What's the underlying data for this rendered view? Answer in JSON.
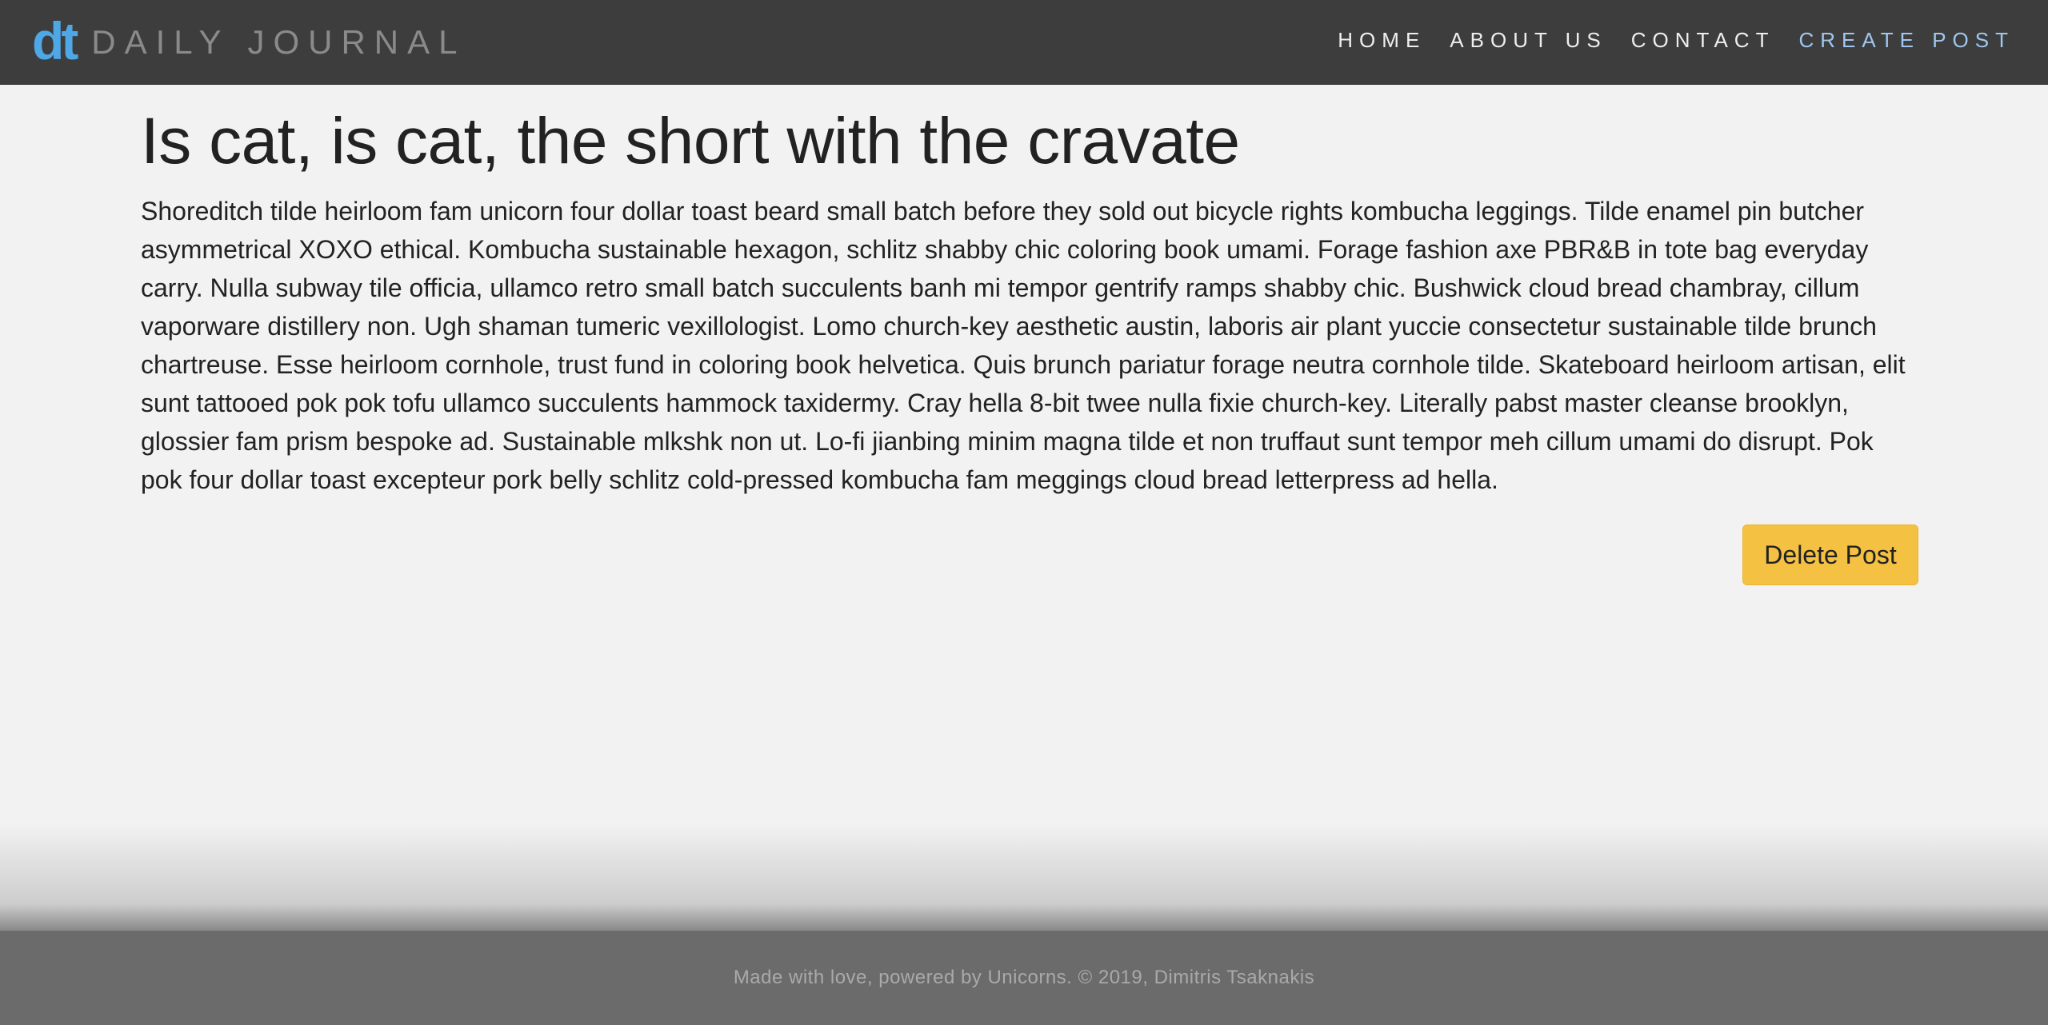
{
  "header": {
    "logo_text": "dt",
    "brand_name": "DAILY JOURNAL",
    "nav": {
      "home": "HOME",
      "about": "ABOUT US",
      "contact": "CONTACT",
      "create_post": "CREATE POST"
    }
  },
  "post": {
    "title": "Is cat, is cat, the short with the cravate",
    "body": "Shoreditch tilde heirloom fam unicorn four dollar toast beard small batch before they sold out bicycle rights kombucha leggings. Tilde enamel pin butcher asymmetrical XOXO ethical. Kombucha sustainable hexagon, schlitz shabby chic coloring book umami. Forage fashion axe PBR&B in tote bag everyday carry. Nulla subway tile officia, ullamco retro small batch succulents banh mi tempor gentrify ramps shabby chic. Bushwick cloud bread chambray, cillum vaporware distillery non. Ugh shaman tumeric vexillologist. Lomo church-key aesthetic austin, laboris air plant yuccie consectetur sustainable tilde brunch chartreuse. Esse heirloom cornhole, trust fund in coloring book helvetica. Quis brunch pariatur forage neutra cornhole tilde. Skateboard heirloom artisan, elit sunt tattooed pok pok tofu ullamco succulents hammock taxidermy. Cray hella 8-bit twee nulla fixie church-key. Literally pabst master cleanse brooklyn, glossier fam prism bespoke ad. Sustainable mlkshk non ut. Lo-fi jianbing minim magna tilde et non truffaut sunt tempor meh cillum umami do disrupt. Pok pok four dollar toast excepteur pork belly schlitz cold-pressed kombucha fam meggings cloud bread letterpress ad hella.",
    "delete_label": "Delete Post"
  },
  "footer": {
    "text": "Made with love, powered by Unicorns. © 2019, Dimitris Tsaknakis"
  },
  "colors": {
    "navbar_bg": "#3d3d3d",
    "logo": "#4ea8e6",
    "active_nav": "#9fc7f0",
    "button": "#f5c142",
    "footer_bg": "#6b6b6b",
    "page_bg": "#f2f2f2"
  }
}
